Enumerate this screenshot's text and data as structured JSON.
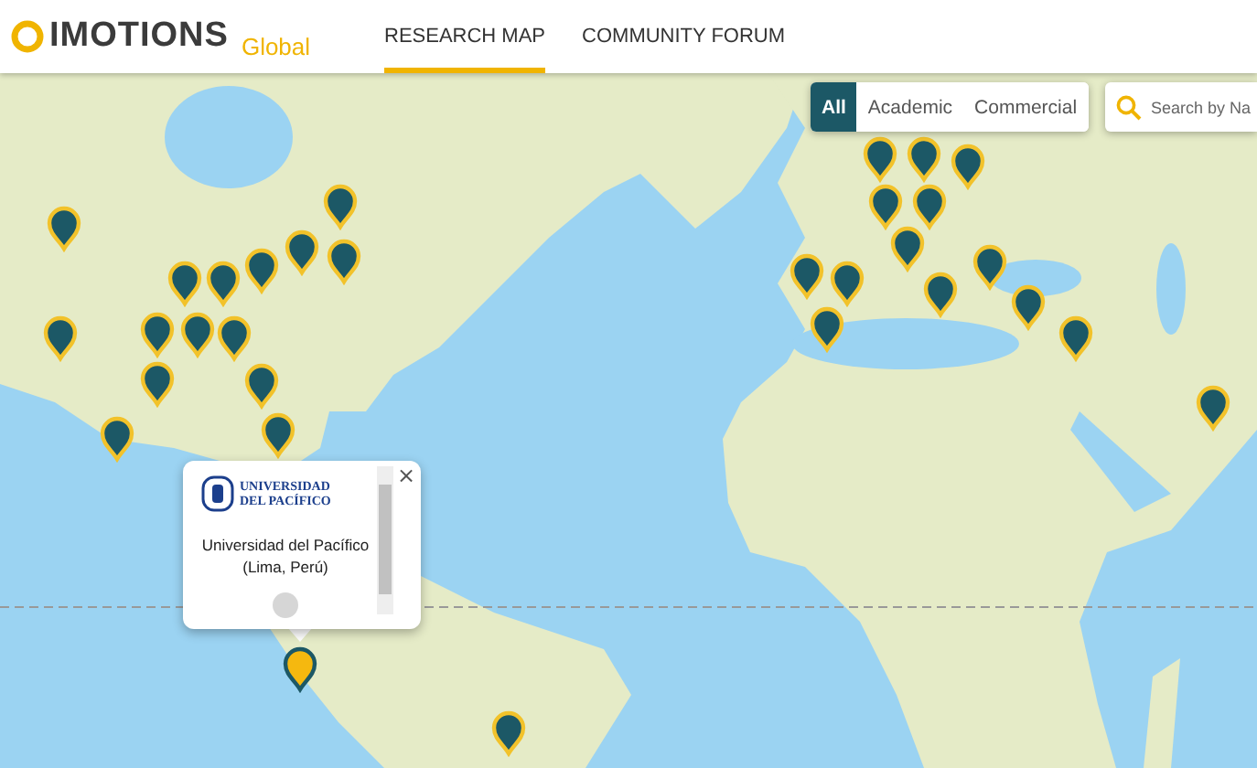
{
  "header": {
    "logo": {
      "name": "IMOTIONS",
      "suffix": "Global"
    },
    "nav": [
      {
        "label": "RESEARCH MAP",
        "selected": true
      },
      {
        "label": "COMMUNITY FORUM",
        "selected": false
      }
    ]
  },
  "map": {
    "filters": [
      {
        "label": "All",
        "selected": true
      },
      {
        "label": "Academic",
        "selected": false
      },
      {
        "label": "Commercial",
        "selected": false
      }
    ],
    "search": {
      "placeholder": "Search by Na"
    },
    "markers": [
      {
        "selected": false
      },
      {
        "selected": false
      },
      {
        "selected": false
      },
      {
        "selected": false
      },
      {
        "selected": false
      },
      {
        "selected": false
      },
      {
        "selected": false
      },
      {
        "selected": false
      },
      {
        "selected": false
      },
      {
        "selected": false
      },
      {
        "selected": false
      },
      {
        "selected": false
      },
      {
        "selected": false
      },
      {
        "selected": false
      },
      {
        "selected": false
      },
      {
        "selected": false
      },
      {
        "selected": false
      },
      {
        "selected": false
      },
      {
        "selected": false
      },
      {
        "selected": false
      },
      {
        "selected": false
      },
      {
        "selected": false
      },
      {
        "selected": false
      },
      {
        "selected": false
      },
      {
        "selected": false
      },
      {
        "selected": false
      },
      {
        "selected": false
      },
      {
        "selected": false
      },
      {
        "selected": false
      },
      {
        "selected": false
      },
      {
        "selected": true
      }
    ],
    "popup": {
      "logo_text": "UNIVERSIDAD DEL PACÍFICO",
      "name": "Universidad del Pacífico",
      "location": "(Lima, Perú)",
      "close": "×"
    }
  }
}
